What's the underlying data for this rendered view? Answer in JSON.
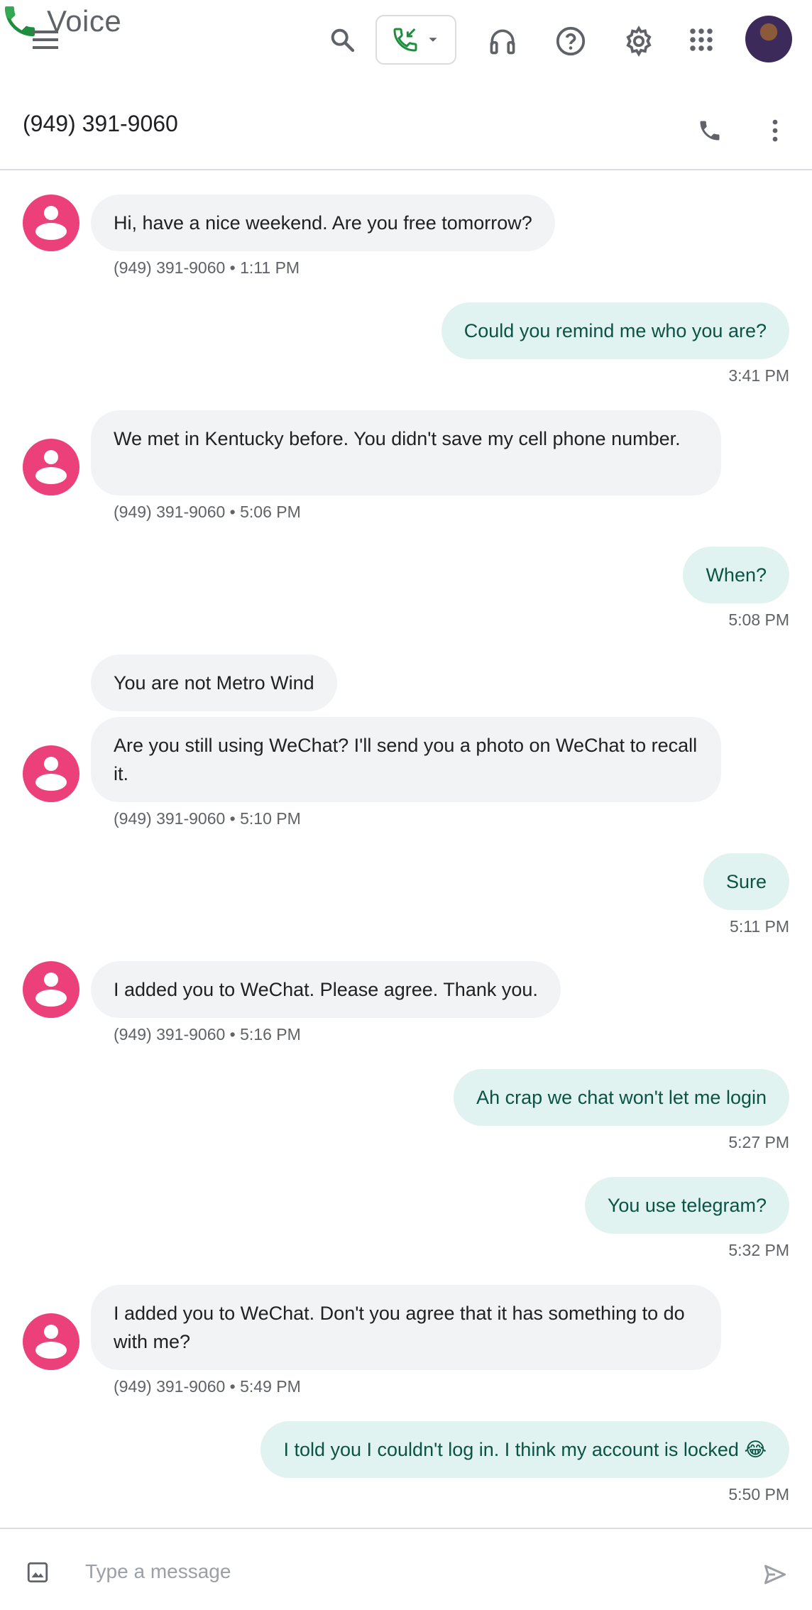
{
  "app": {
    "name": "Voice"
  },
  "conversation": {
    "title": "(949) 391-9060"
  },
  "messages": [
    {
      "dir": "in",
      "text": "Hi, have a nice weekend. Are you free tomorrow?",
      "meta": "(949) 391-9060 • 1:11 PM"
    },
    {
      "dir": "out",
      "text": "Could you remind me who you are?",
      "meta": "3:41 PM"
    },
    {
      "dir": "in",
      "text": "We met in Kentucky before. You didn't save my cell phone number.",
      "meta": "(949) 391-9060 • 5:06 PM"
    },
    {
      "dir": "out",
      "text": "When?",
      "meta": "5:08 PM"
    },
    {
      "dir": "in",
      "text": "You are not Metro Wind"
    },
    {
      "dir": "in",
      "text": "Are you still using WeChat? I'll send you a photo on WeChat to recall it.",
      "meta": "(949) 391-9060 • 5:10 PM"
    },
    {
      "dir": "out",
      "text": "Sure",
      "meta": "5:11 PM"
    },
    {
      "dir": "in",
      "text": "I added you to WeChat. Please agree. Thank you.",
      "meta": "(949) 391-9060 • 5:16 PM"
    },
    {
      "dir": "out",
      "text": "Ah crap we chat won't let me login",
      "meta": "5:27 PM"
    },
    {
      "dir": "out",
      "text": "You use telegram?",
      "meta": "5:32 PM"
    },
    {
      "dir": "in",
      "text": "I added you to WeChat. Don't you agree that it has something to do with me?",
      "meta": "(949) 391-9060 • 5:49 PM"
    },
    {
      "dir": "out",
      "text": "I told you I couldn't log in. I think my account is locked 😂",
      "meta": "5:50 PM"
    }
  ],
  "composer": {
    "placeholder": "Type a message"
  },
  "colors": {
    "accent": "#1e8e3e",
    "contact_avatar": "#ec407a",
    "outgoing_bubble": "#e1f3f0",
    "incoming_bubble": "#f1f3f4"
  },
  "icons": [
    "menu-icon",
    "voice-logo-icon",
    "search-icon",
    "incoming-call-icon",
    "headset-icon",
    "help-icon",
    "settings-icon",
    "apps-icon",
    "phone-icon",
    "more-vert-icon",
    "contact-avatar-icon",
    "image-icon",
    "send-icon"
  ]
}
